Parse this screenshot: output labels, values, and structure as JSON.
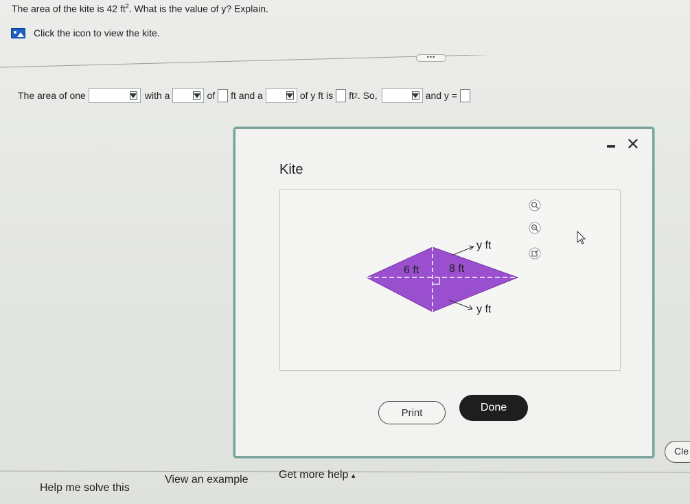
{
  "question": {
    "prefix": "The area of the kite is 42 ft",
    "exp": "2",
    "suffix": ". What is the value of y? Explain."
  },
  "kite_link": {
    "label": "Click the icon to view the kite."
  },
  "more_label": "•••",
  "answer": {
    "t1": "The area of one",
    "t2": "with a",
    "t3": "of",
    "t4": "ft and a",
    "t5": "of y ft is",
    "t6": "ft",
    "t6_exp": "2",
    "t7": ". So,",
    "t8": "and y ="
  },
  "modal": {
    "title": "Kite",
    "figure": {
      "label_y_top": "y ft",
      "label_6": "6 ft",
      "label_8": "8 ft",
      "label_y_bottom": "y ft",
      "fill_color": "#9a4fcf"
    },
    "print_label": "Print",
    "done_label": "Done"
  },
  "clear_label": "Cle",
  "bottom": {
    "help": "Help me solve this",
    "example": "View an example",
    "more_help": "Get more help",
    "more_help_arrow": "▴"
  }
}
